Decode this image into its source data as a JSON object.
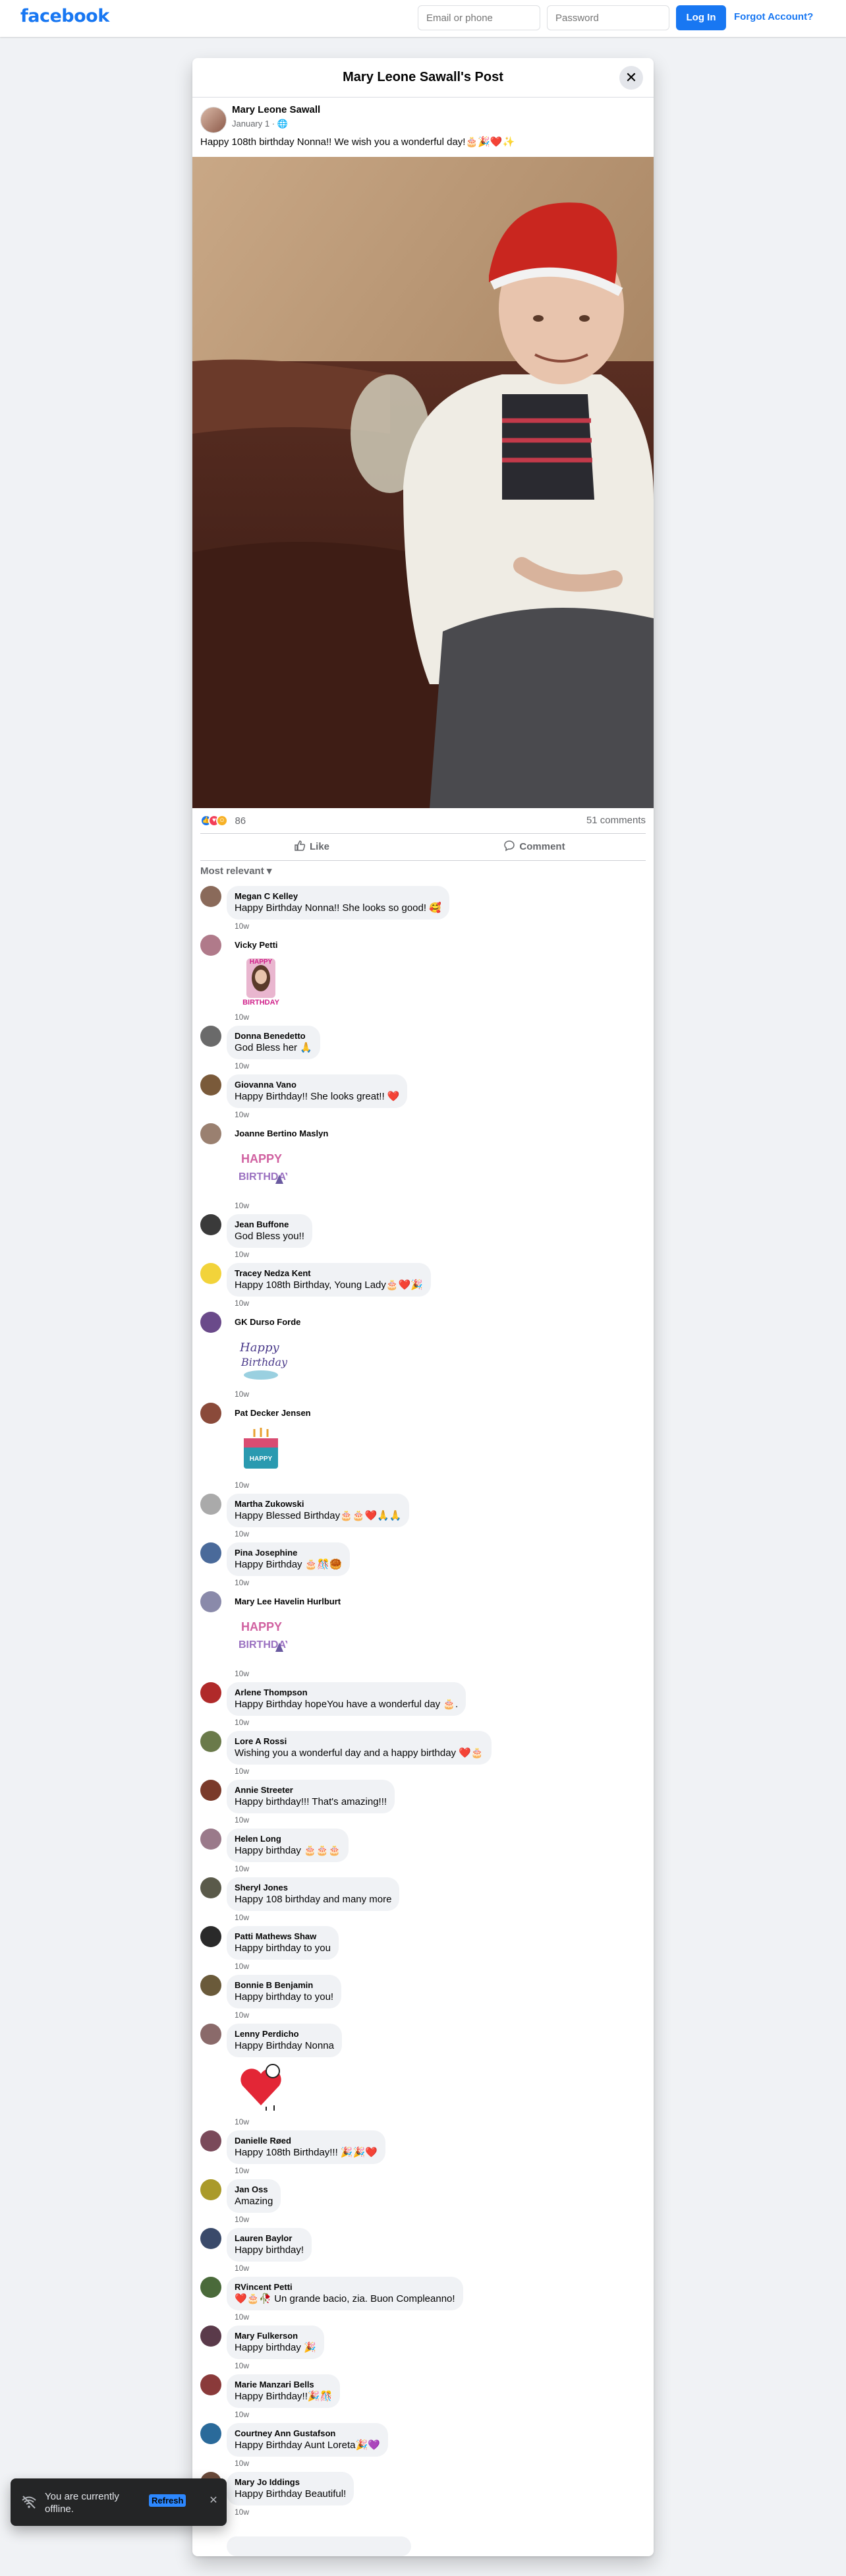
{
  "brand": {
    "logo": "facebook",
    "accent": "#1877f2"
  },
  "header": {
    "email_placeholder": "Email or phone",
    "password_placeholder": "Password",
    "login_label": "Log In",
    "forgot_label": "Forgot Account?"
  },
  "dialog": {
    "title": "Mary Leone Sawall's Post",
    "close_icon": "close-icon"
  },
  "post": {
    "author": "Mary Leone Sawall",
    "date": "January 1 ·",
    "text": "Happy 108th birthday Nonna!! We wish you a wonderful day!🎂🎉❤️✨",
    "reaction_count": "86",
    "comment_count": "51 comments",
    "like_label": "Like",
    "comment_label": "Comment",
    "sort_label": "Most relevant ▾"
  },
  "comments": [
    {
      "name": "Megan C Kelley",
      "text": "Happy Birthday Nonna!! She looks so good! 🥰",
      "time": "10w",
      "avatar": "#8a6a5a"
    },
    {
      "name": "Vicky Petti",
      "text": "",
      "sticker": "happy-birthday-photo-sticker",
      "time": "10w",
      "avatar": "#b07a8a"
    },
    {
      "name": "Donna Benedetto",
      "text": "God Bless her 🙏",
      "time": "10w",
      "avatar": "#6a6a6a"
    },
    {
      "name": "Giovanna Vano",
      "text": "Happy Birthday!! She looks great!! ❤️",
      "time": "10w",
      "avatar": "#7a5a3a"
    },
    {
      "name": "Joanne Bertino Maslyn",
      "text": "",
      "sticker": "happy-birthday-sticker",
      "time": "10w",
      "avatar": "#9a8070"
    },
    {
      "name": "Jean Buffone",
      "text": "God Bless you!!",
      "time": "10w",
      "avatar": "#3a3a3a"
    },
    {
      "name": "Tracey Nedza Kent",
      "text": "Happy 108th Birthday, Young Lady🎂❤️🎉",
      "time": "10w",
      "avatar": "#f2d33a"
    },
    {
      "name": "GK Durso Forde",
      "text": "",
      "sticker": "happy-birthday-script-sticker",
      "time": "10w",
      "avatar": "#6a4a8a"
    },
    {
      "name": "Pat Decker Jensen",
      "text": "",
      "sticker": "happy-birthday-cake-sticker",
      "time": "10w",
      "avatar": "#8a4a3a"
    },
    {
      "name": "Martha Zukowski",
      "text": "Happy Blessed Birthday🎂🎂❤️🙏🙏",
      "time": "10w",
      "avatar": "#aaaaaa"
    },
    {
      "name": "Pina Josephine",
      "text": "Happy Birthday 🎂🎊🥮",
      "time": "10w",
      "avatar": "#4a6a9a"
    },
    {
      "name": "Mary Lee Havelin Hurlburt",
      "text": "",
      "sticker": "happy-birthday-sticker",
      "time": "10w",
      "avatar": "#8a8aaa"
    },
    {
      "name": "Arlene Thompson",
      "text": "Happy Birthday hopeYou have a wonderful day 🎂.",
      "time": "10w",
      "avatar": "#b02a2a"
    },
    {
      "name": "Lore A Rossi",
      "text": "Wishing you a wonderful day and a happy birthday ❤️🎂",
      "time": "10w",
      "avatar": "#6a7a4a"
    },
    {
      "name": "Annie Streeter",
      "text": "Happy birthday!!! That's amazing!!!",
      "time": "10w",
      "avatar": "#7a3a2a"
    },
    {
      "name": "Helen Long",
      "text": "Happy birthday 🎂🎂🎂",
      "time": "10w",
      "avatar": "#9a7a8a"
    },
    {
      "name": "Sheryl Jones",
      "text": "Happy 108 birthday and many more",
      "time": "10w",
      "avatar": "#5a5a4a"
    },
    {
      "name": "Patti Mathews Shaw",
      "text": "Happy birthday to you",
      "time": "10w",
      "avatar": "#2a2a2a"
    },
    {
      "name": "Bonnie B Benjamin",
      "text": "Happy birthday to you!",
      "time": "10w",
      "avatar": "#6a5a3a"
    },
    {
      "name": "Lenny Perdicho",
      "text": "Happy Birthday Nonna",
      "sticker": "heart-character-sticker",
      "time": "10w",
      "avatar": "#8a6a6a"
    },
    {
      "name": "Danielle Røed",
      "text": "Happy 108th Birthday!!! 🎉🎉❤️",
      "time": "10w",
      "avatar": "#7a4a5a"
    },
    {
      "name": "Jan Oss",
      "text": "Amazing",
      "time": "10w",
      "avatar": "#aa9a2a"
    },
    {
      "name": "Lauren Baylor",
      "text": "Happy birthday!",
      "time": "10w",
      "avatar": "#3a4a6a"
    },
    {
      "name": "RVincent Petti",
      "text": "❤️🎂🥀 Un grande bacio, zia. Buon Compleanno!",
      "time": "10w",
      "avatar": "#4a6a3a"
    },
    {
      "name": "Mary Fulkerson",
      "text": "Happy birthday 🎉",
      "time": "10w",
      "avatar": "#5a3a4a"
    },
    {
      "name": "Marie Manzari Bells",
      "text": "Happy Birthday!!🎉🎊",
      "time": "10w",
      "avatar": "#8a3a3a"
    },
    {
      "name": "Courtney Ann Gustafson",
      "text": "Happy Birthday Aunt Loreta🎉💜",
      "time": "10w",
      "avatar": "#2a6a9a"
    },
    {
      "name": "Mary Jo Iddings",
      "text": "Happy Birthday Beautiful!",
      "time": "10w",
      "avatar": "#6a4a3a"
    }
  ],
  "toast": {
    "text": "You are currently offline.",
    "action": "Refresh",
    "icon": "wifi-off-icon"
  }
}
